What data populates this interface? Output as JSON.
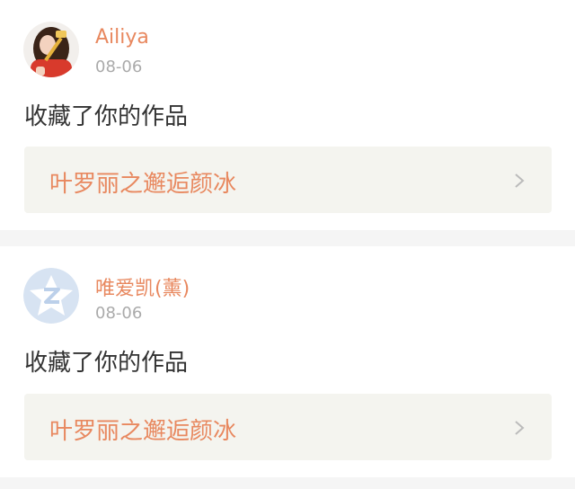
{
  "notifications": [
    {
      "username": "Ailiya",
      "date": "08-06",
      "action": "收藏了你的作品",
      "work_title": "叶罗丽之邂逅颜冰",
      "avatar": "photo-avatar"
    },
    {
      "username": "唯爱凯(薰)",
      "date": "08-06",
      "action": "收藏了你的作品",
      "work_title": "叶罗丽之邂逅颜冰",
      "avatar": "default-z-avatar-icon"
    }
  ],
  "colors": {
    "accent": "#e8885f",
    "date": "#aaaaaa",
    "text": "#333333",
    "link_bg": "#f4f4ef",
    "page_bg": "#f5f5f5",
    "default_avatar": "#c9d9ee"
  }
}
